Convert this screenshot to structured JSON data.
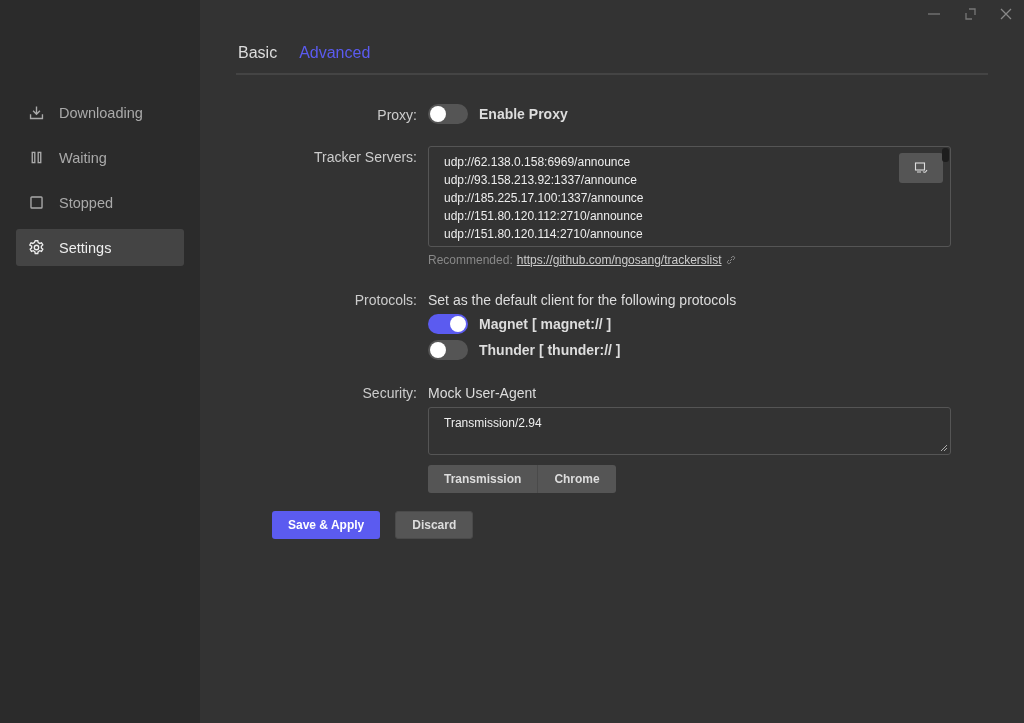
{
  "sidebar": {
    "items": [
      {
        "label": "Downloading",
        "selected": false
      },
      {
        "label": "Waiting",
        "selected": false
      },
      {
        "label": "Stopped",
        "selected": false
      },
      {
        "label": "Settings",
        "selected": true
      }
    ]
  },
  "tabs": [
    {
      "label": "Basic",
      "selected": false
    },
    {
      "label": "Advanced",
      "selected": true
    }
  ],
  "proxy": {
    "label": "Proxy:",
    "toggle": {
      "label": "Enable Proxy",
      "on": false
    }
  },
  "tracker_servers": {
    "label": "Tracker Servers:",
    "lines": [
      "udp://62.138.0.158:6969/announce",
      "udp://93.158.213.92:1337/announce",
      "udp://185.225.17.100:1337/announce",
      "udp://151.80.120.112:2710/announce",
      "udp://151.80.120.114:2710/announce"
    ],
    "hint": "Recommended:",
    "link": "https://github.com/ngosang/trackerslist"
  },
  "protocols": {
    "label": "Protocols:",
    "description": "Set as the default client for the following protocols",
    "toggles": [
      {
        "label": "Magnet [ magnet:// ]",
        "on": true
      },
      {
        "label": "Thunder [ thunder:// ]",
        "on": false
      }
    ]
  },
  "security": {
    "label": "Security:",
    "title": "Mock User-Agent",
    "value": "Transmission/2.94",
    "presets": [
      "Transmission",
      "Chrome"
    ]
  },
  "buttons": [
    {
      "label": "Save & Apply",
      "kind": "primary"
    },
    {
      "label": "Discard",
      "kind": "secondary"
    }
  ]
}
